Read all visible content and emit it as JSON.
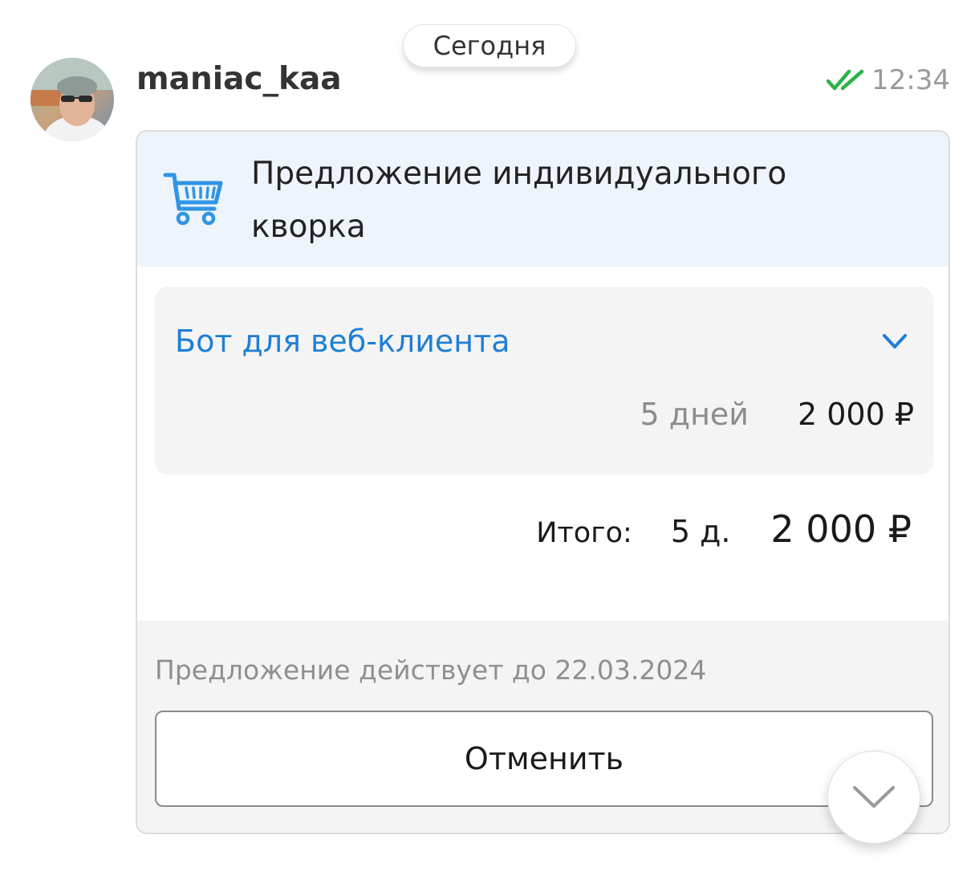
{
  "date_separator": "Сегодня",
  "message": {
    "author": "maniac_kaa",
    "time": "12:34",
    "read_icon": "double-check-icon",
    "read_color": "#2bb34a",
    "avatar_icon": "user-avatar"
  },
  "offer": {
    "icon": "shopping-cart-icon",
    "accent_color": "#1f7fd4",
    "title": "Предложение индивидуального кворка",
    "item": {
      "title": "Бот для веб-клиента",
      "days": "5 дней",
      "price": "2 000 ₽",
      "toggle_icon": "chevron-down-icon"
    },
    "total": {
      "label": "Итого:",
      "days": "5 д.",
      "price": "2 000 ₽"
    },
    "expiry_text": "Предложение действует до 22.03.2024",
    "cancel_label": "Отменить"
  },
  "scroll_button_icon": "chevron-down-icon"
}
